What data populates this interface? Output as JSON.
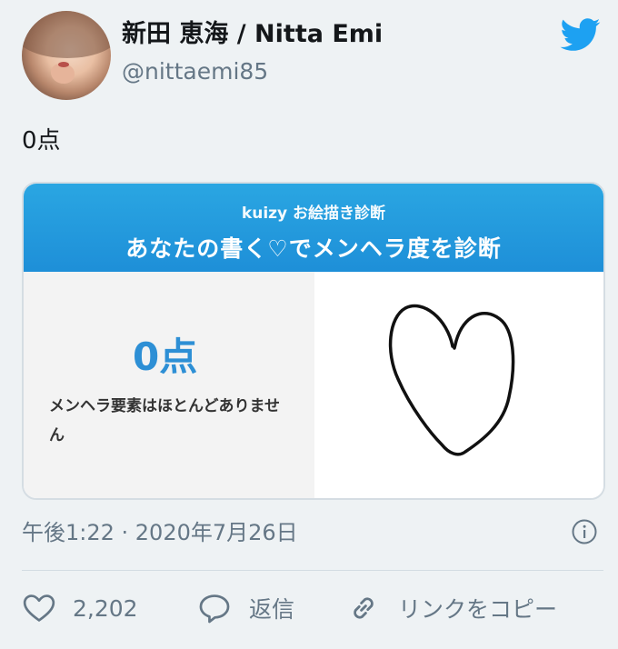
{
  "header": {
    "display_name": "新田 恵海 / Nitta Emi",
    "handle": "@nittaemi85",
    "avatar_icon": "user-avatar",
    "brand_icon": "twitter-bird-icon"
  },
  "tweet": {
    "text": "0点"
  },
  "card": {
    "banner_top": "kuizy お絵描き診断",
    "banner_main": "あなたの書く♡でメンヘラ度を診断",
    "score": "0点",
    "description": "メンヘラ要素はほとんどありません",
    "image_icon": "heart-drawing",
    "banner_color": "#2196dc",
    "score_color": "#2d8fd5"
  },
  "meta": {
    "timestamp": "午後1:22 · 2020年7月26日",
    "info_icon": "info-icon"
  },
  "actions": {
    "like_count": "2,202",
    "reply_label": "返信",
    "copy_link_label": "リンクをコピー"
  },
  "colors": {
    "background": "#eef2f4",
    "twitter_blue": "#1da1f2",
    "secondary_text": "#657786"
  }
}
